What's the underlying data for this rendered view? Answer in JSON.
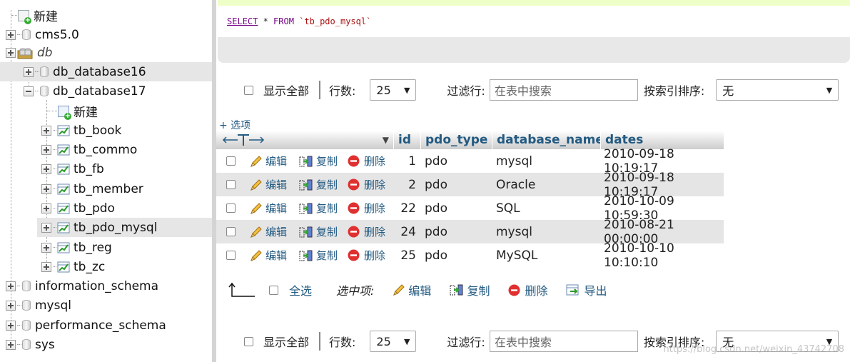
{
  "sidebar": {
    "items": [
      {
        "label": "新建",
        "level": 0,
        "kind": "new"
      },
      {
        "label": "cms5.0",
        "level": 0,
        "kind": "db"
      },
      {
        "label": "db",
        "level": 0,
        "kind": "group"
      },
      {
        "label": "db_database16",
        "level": 1,
        "kind": "db"
      },
      {
        "label": "db_database17",
        "level": 1,
        "kind": "db-open"
      },
      {
        "label": "新建",
        "level": 2,
        "kind": "new"
      },
      {
        "label": "tb_book",
        "level": 2,
        "kind": "table"
      },
      {
        "label": "tb_commo",
        "level": 2,
        "kind": "table"
      },
      {
        "label": "tb_fb",
        "level": 2,
        "kind": "table"
      },
      {
        "label": "tb_member",
        "level": 2,
        "kind": "table"
      },
      {
        "label": "tb_pdo",
        "level": 2,
        "kind": "table"
      },
      {
        "label": "tb_pdo_mysql",
        "level": 2,
        "kind": "table"
      },
      {
        "label": "tb_reg",
        "level": 2,
        "kind": "table"
      },
      {
        "label": "tb_zc",
        "level": 2,
        "kind": "table"
      },
      {
        "label": "information_schema",
        "level": 0,
        "kind": "db"
      },
      {
        "label": "mysql",
        "level": 0,
        "kind": "db"
      },
      {
        "label": "performance_schema",
        "level": 0,
        "kind": "db"
      },
      {
        "label": "sys",
        "level": 0,
        "kind": "db"
      }
    ]
  },
  "sql": {
    "select": "SELECT",
    "star": " * ",
    "from": "FROM",
    "table": "`tb_pdo_mysql`"
  },
  "nav": {
    "show_all": "显示全部",
    "rows_label": "行数:",
    "rows_value": "25",
    "filter_label": "过滤行:",
    "filter_placeholder": "在表中搜索",
    "sort_label": "按索引排序:",
    "sort_value": "无"
  },
  "options_link": "+ 选项",
  "grid": {
    "columns": [
      "id",
      "pdo_type",
      "database_name",
      "dates"
    ],
    "actions": {
      "edit": "编辑",
      "copy": "复制",
      "delete": "删除"
    },
    "rows": [
      {
        "id": "1",
        "pdo_type": "pdo",
        "database_name": "mysql",
        "dates": "2010-09-18 10:19:17"
      },
      {
        "id": "2",
        "pdo_type": "pdo",
        "database_name": "Oracle",
        "dates": "2010-09-18 10:19:17"
      },
      {
        "id": "22",
        "pdo_type": "pdo",
        "database_name": "SQL",
        "dates": "2010-10-09 10:59:30"
      },
      {
        "id": "24",
        "pdo_type": "pdo",
        "database_name": "mysql",
        "dates": "2010-08-21 00:00:00"
      },
      {
        "id": "25",
        "pdo_type": "pdo",
        "database_name": "MySQL",
        "dates": "2010-10-10 10:10:10"
      }
    ]
  },
  "bulk": {
    "select_all": "全选",
    "with_selected": "选中项:",
    "edit": "编辑",
    "copy": "复制",
    "delete": "删除",
    "export": "导出"
  },
  "watermark": "https://blog.csdn.net/weixin_43742708",
  "colors": {
    "link": "#235a81",
    "highlight": "#e6e6e6",
    "sql_bar": "#efffc8"
  }
}
